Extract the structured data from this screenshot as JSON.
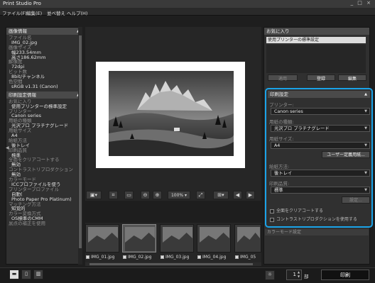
{
  "app": {
    "title": "Print Studio Pro",
    "window_controls": "_ □ ×"
  },
  "menu": [
    "ファイル(F)",
    "編集(E)",
    "並べ替え",
    "ヘルプ(H)"
  ],
  "left": {
    "section1_title": "画像情報",
    "info": [
      {
        "k": "ファイル名",
        "v": "IMG_02.jpg"
      },
      {
        "k": "画像サイズ",
        "v": "幅233.54mm"
      },
      {
        "k": "",
        "v": "高さ186.62mm"
      },
      {
        "k": "解像度",
        "v": "72dpi"
      },
      {
        "k": "ビット数",
        "v": "8bit/チャンネル"
      },
      {
        "k": "色空間",
        "v": "sRGB v1.31 (Canon)"
      }
    ],
    "section2_title": "印刷設定情報",
    "settings": [
      {
        "k": "お気に入り",
        "v": "使用プリンターの標準設定"
      },
      {
        "k": "プリンター",
        "v": "Canon          series"
      },
      {
        "k": "用紙の種類",
        "v": "光沢プロ プラチナグレード"
      },
      {
        "k": "用紙サイズ",
        "v": "A4"
      },
      {
        "k": "給紙方法",
        "v": "後トレイ"
      },
      {
        "k": "印刷品質",
        "v": "標準"
      },
      {
        "k": "全面をクリアコートする",
        "v": "無効"
      },
      {
        "k": "コントラストリプロダクション",
        "v": "無効"
      },
      {
        "k": "カラーモード",
        "v": "ICCプロファイルを使う"
      },
      {
        "k": "プリンタープロファイル",
        "v": "自動(           "
      },
      {
        "k": "",
        "v": "Photo Paper Pro Platinum)"
      },
      {
        "k": "マッチング方法",
        "v": "知覚的"
      },
      {
        "k": "カラー変換方式",
        "v": "OS標準のCMM"
      },
      {
        "k": "黒点の補正を使用",
        "v": ""
      }
    ]
  },
  "toolbar": {
    "zoom": "100%"
  },
  "thumbnails": [
    "IMG_01.jpg",
    "IMG_02.jpg",
    "IMG_03.jpg",
    "IMG_04.jpg",
    "IMG_05"
  ],
  "right": {
    "favorites_title": "お気に入り",
    "favorites_value": "使用プリンターの標準設定",
    "apply": "適用",
    "register": "登録",
    "edit": "編集",
    "print_settings_title": "印刷設定",
    "printer_label": "プリンター:",
    "printer_value": "Canon          series",
    "media_label": "用紙の種類:",
    "media_value": "光沢プロ プラチナグレード",
    "size_label": "用紙サイズ:",
    "size_value": "A4",
    "custom_size": "ユーザー定義用紙...",
    "feed_label": "給紙方法:",
    "feed_value": "後トレイ",
    "quality_label": "印刷品質:",
    "quality_value": "標準",
    "quality_settings": "設定...",
    "clear_coat": "全面をクリアコートする",
    "contrast": "コントラストリプロダクションを使用する",
    "color_section": "カラーモード設定"
  },
  "bottom": {
    "copies": "1",
    "unit": "部",
    "print": "印刷"
  },
  "highlight_color": "#1aa3e8"
}
